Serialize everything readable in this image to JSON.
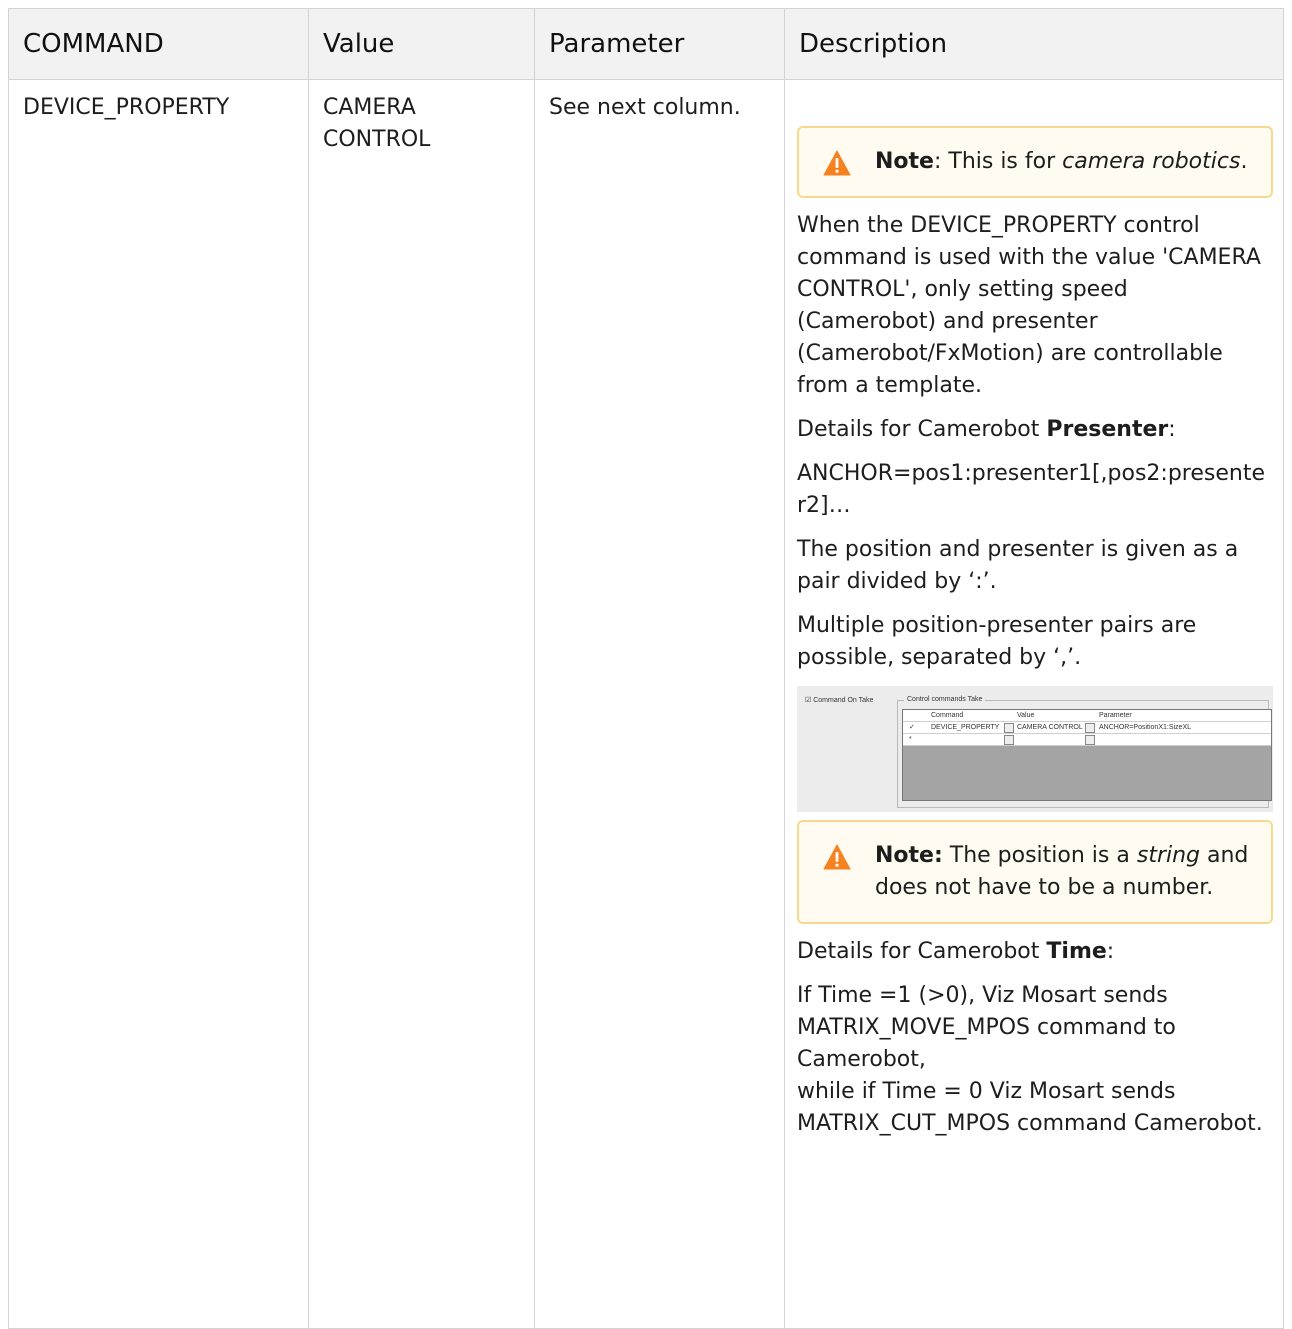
{
  "table": {
    "headers": [
      "COMMAND",
      "Value",
      "Parameter",
      "Description"
    ],
    "row": {
      "command": "DEVICE_PROPERTY",
      "value": "CAMERA CONTROL",
      "parameter": "See next column.",
      "description": {
        "note1": {
          "label": "Note",
          "text_prefix": ": This is for ",
          "text_em": "camera robotics",
          "text_suffix": "."
        },
        "para1": "When the DEVICE_PROPERTY control command is used with the value 'CAMERA CONTROL', only setting speed (Camerobot) and presenter (Camerobot/FxMotion) are controllable from a template.",
        "para2_prefix": "Details for Camerobot ",
        "para2_bold": "Presenter",
        "para2_suffix": ":",
        "para3": "ANCHOR=pos1:presenter1[,pos2:presenter2]…",
        "para4": "The position and presenter is given as a pair divided by ‘:’.",
        "para5": "Multiple position-presenter pairs are possible, separated by ‘,’.",
        "screenshot": {
          "checkbox_label": "Command On Take",
          "group_title": "Control commands Take",
          "grid_headers": [
            "Command",
            "Value",
            "Parameter"
          ],
          "grid_row": {
            "marker": "✓",
            "command": "DEVICE_PROPERTY",
            "value": "CAMERA CONTROL",
            "parameter": "ANCHOR=PositionX1:SizeXL"
          },
          "new_row_marker": "*"
        },
        "note2": {
          "label": "Note:",
          "text_prefix": " The position is a ",
          "text_em": "string",
          "text_suffix": " and does not have to be a number."
        },
        "para6_prefix": "Details for Camerobot ",
        "para6_bold": "Time",
        "para6_suffix": ":",
        "para7_line1": "If Time =1 (>0), Viz Mosart sends MATRIX_MOVE_MPOS command to Camerobot,",
        "para7_line2": "while if Time = 0 Viz Mosart sends MATRIX_CUT_MPOS command Camerobot."
      }
    }
  },
  "colors": {
    "header_bg": "#f2f2f2",
    "border": "#d3d3d3",
    "note_bg": "#fffbf0",
    "note_border": "#f6d98a",
    "warning_icon": "#f5821f"
  }
}
